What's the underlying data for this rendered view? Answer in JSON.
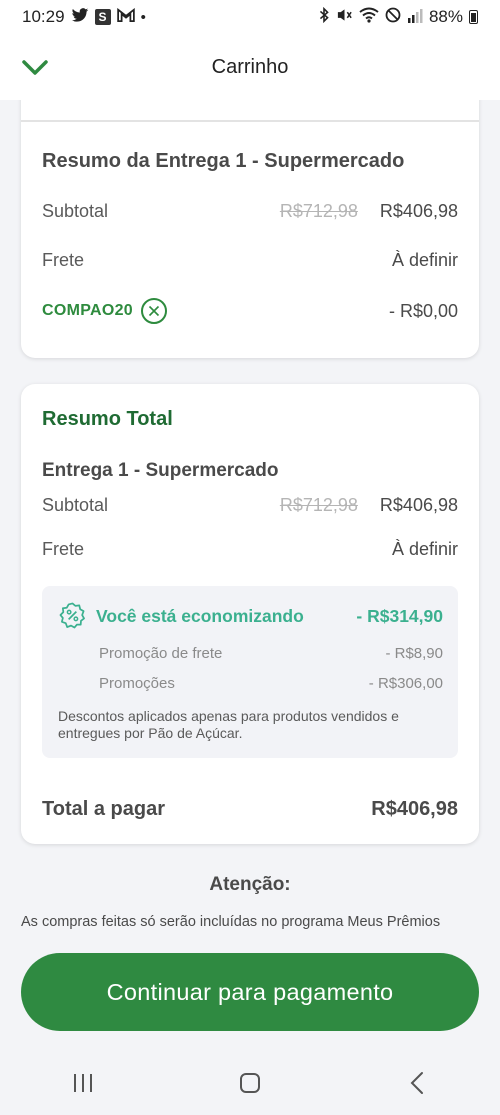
{
  "status_bar": {
    "time": "10:29",
    "s_badge": "S",
    "battery_pct": "88%"
  },
  "header": {
    "title": "Carrinho"
  },
  "delivery_summary": {
    "title": "Resumo da Entrega 1 - Supermercado",
    "subtotal_label": "Subtotal",
    "subtotal_old": "R$712,98",
    "subtotal_new": "R$406,98",
    "freight_label": "Frete",
    "freight_value": "À definir",
    "coupon_code": "COMPAO20",
    "coupon_discount": "- R$0,00"
  },
  "total_summary": {
    "title": "Resumo Total",
    "delivery_title": "Entrega 1 - Supermercado",
    "subtotal_label": "Subtotal",
    "subtotal_old": "R$712,98",
    "subtotal_new": "R$406,98",
    "freight_label": "Frete",
    "freight_value": "À definir",
    "savings": {
      "label": "Você está economizando",
      "value": "- R$314,90",
      "items": [
        {
          "label": "Promoção de frete",
          "value": "- R$8,90"
        },
        {
          "label": "Promoções",
          "value": "- R$306,00"
        }
      ],
      "note": "Descontos aplicados apenas para produtos vendidos e entregues por Pão de Açúcar."
    },
    "pay_label": "Total a pagar",
    "pay_value": "R$406,98"
  },
  "attention": {
    "title": "Atenção:",
    "text": "As compras feitas só serão incluídas no programa Meus Prêmios"
  },
  "cta": {
    "label": "Continuar para pagamento"
  },
  "colors": {
    "brand_green": "#2f8a41",
    "title_green": "#1f6b33",
    "savings_teal": "#3bb08f"
  },
  "icons": [
    "twitter-icon",
    "gmail-icon",
    "bluetooth-icon",
    "mute-icon",
    "wifi-icon",
    "dnd-icon",
    "signal-icon",
    "battery-icon",
    "chevron-down-icon",
    "close-circle-icon",
    "percent-badge-icon",
    "recents-icon",
    "home-icon",
    "back-icon"
  ]
}
